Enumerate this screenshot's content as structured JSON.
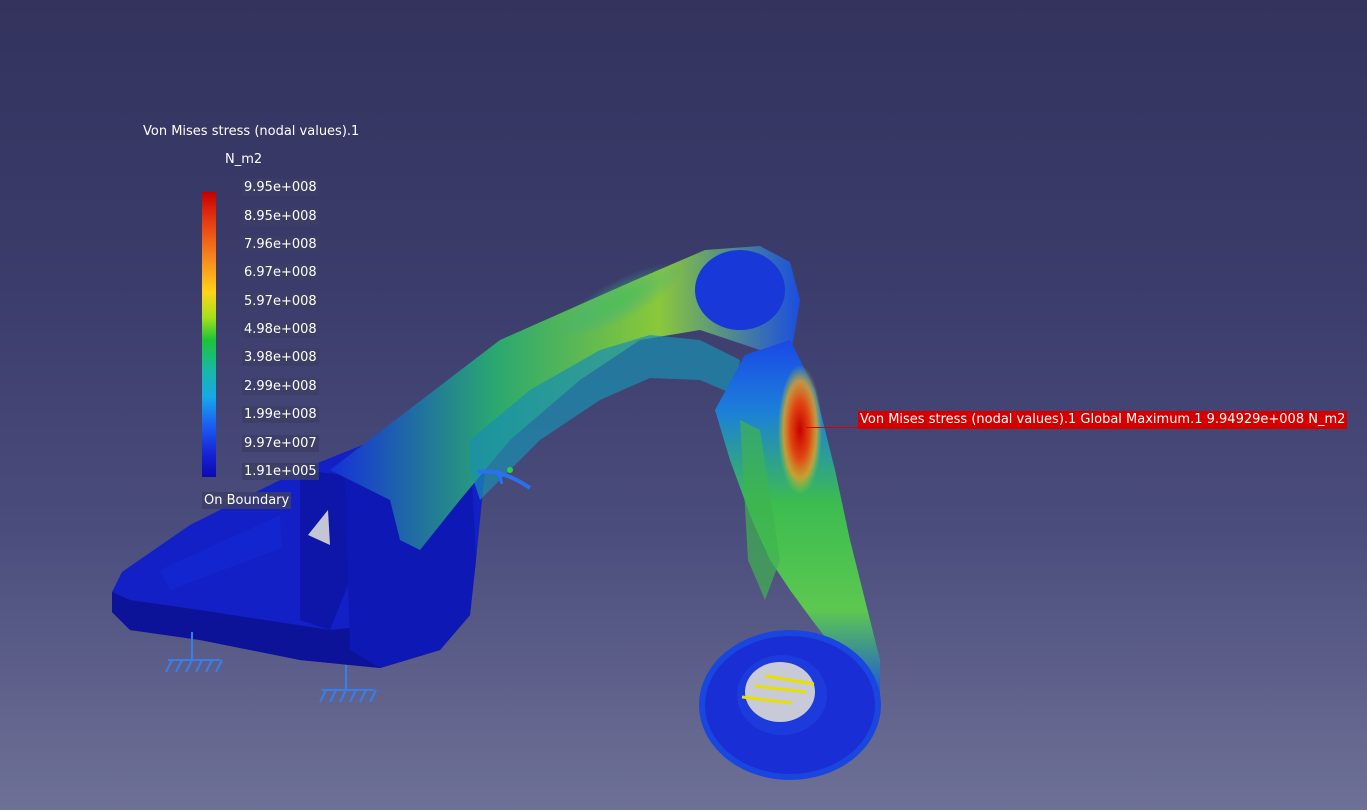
{
  "legend": {
    "title": "Von Mises stress (nodal values).1",
    "unit": "N_m2",
    "values": [
      "9.95e+008",
      "8.95e+008",
      "7.96e+008",
      "6.97e+008",
      "5.97e+008",
      "4.98e+008",
      "3.98e+008",
      "2.99e+008",
      "1.99e+008",
      "9.97e+007",
      "1.91e+005"
    ],
    "boundary": "On Boundary"
  },
  "callout": {
    "text": "Von Mises stress (nodal values).1  Global Maximum.1  9.94929e+008 N_m2"
  },
  "colors": {
    "background_top": "#33335e",
    "background_bottom": "#6e7196",
    "max": "#c40000",
    "min": "#0a0ab0",
    "callout_bg": "#d40000",
    "restraint": "#3a7ee8",
    "load_arrow": "#e8e000"
  },
  "icons": {
    "restraint": "clamp-restraint-icon",
    "load": "distributed-force-arrows-icon",
    "axis": "compass-axis-icon"
  }
}
